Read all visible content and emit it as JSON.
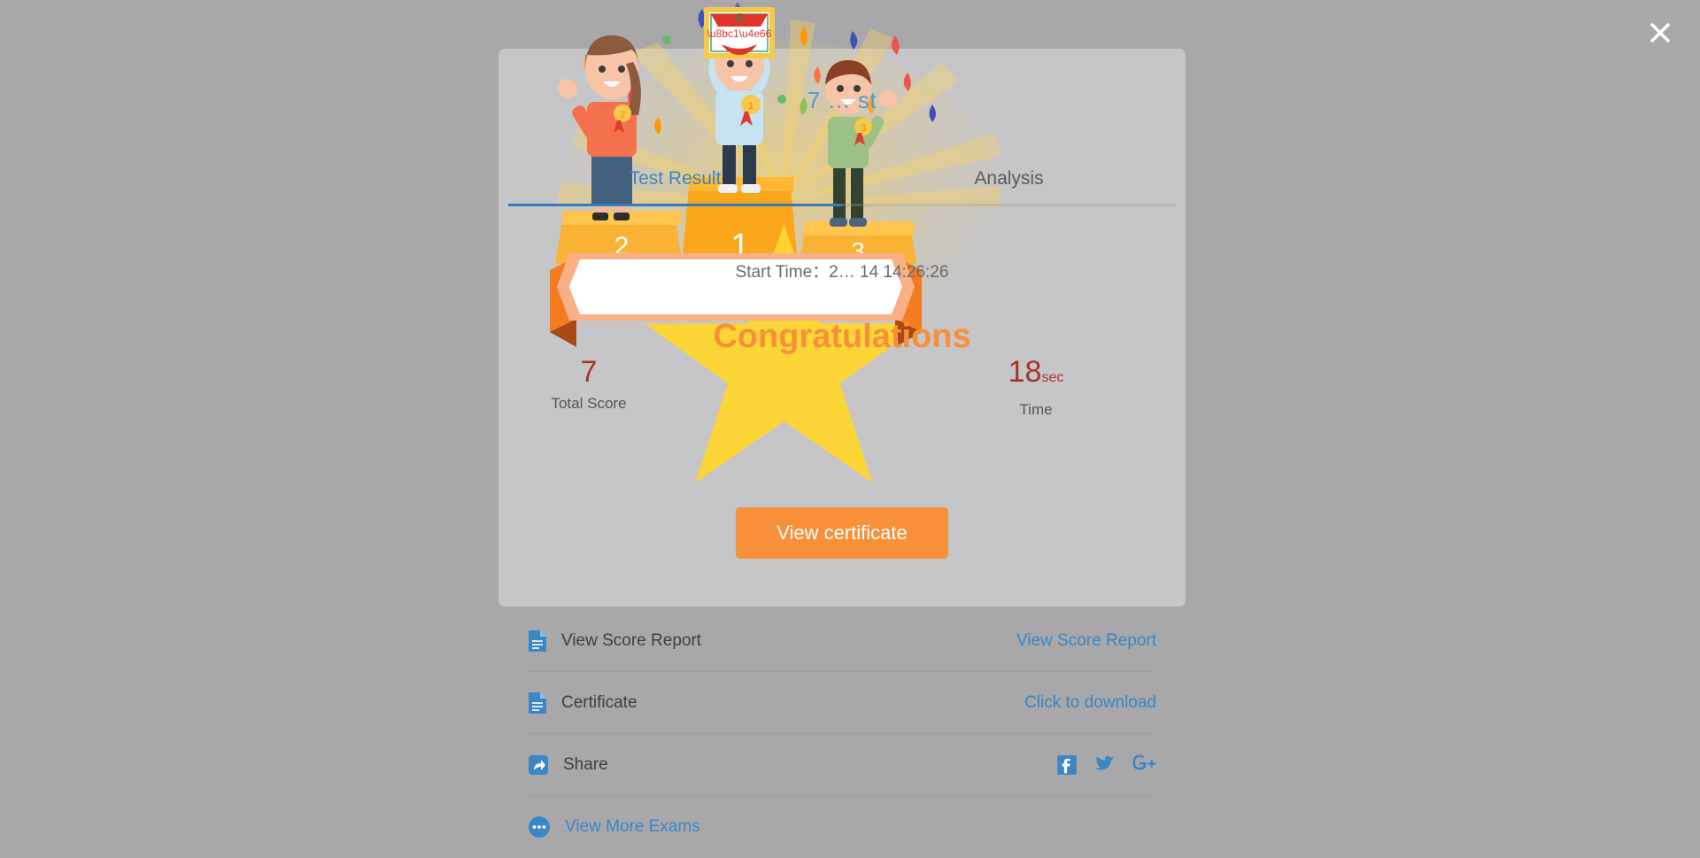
{
  "window": {
    "background_color": "#a8a8ab",
    "close_label": "✖"
  },
  "modal": {
    "exam_title": "7  …  st",
    "tabs": [
      {
        "label": "Test Result",
        "active": true
      },
      {
        "label": "Analysis",
        "active": false
      }
    ],
    "start_time": "Start Time：2… 14 14:26:26",
    "stats": [
      {
        "value": "7",
        "unit": "",
        "label": "Total Score",
        "color": "#a8342c"
      },
      {
        "value": "18",
        "unit": "sec",
        "label": "Time",
        "color": "#a8342c"
      }
    ],
    "banner_text": "Congratulations",
    "banner_color": "#f79038",
    "podium": {
      "first": "1",
      "second": "2",
      "third": "3",
      "certificate_text": "证书"
    },
    "primary_button": {
      "label": "View certificate",
      "color": "#f79038"
    },
    "actions": [
      {
        "icon": "document-icon",
        "label": "View Score Report",
        "label_is_link": false,
        "right_label": "View Score Report",
        "right_type": "link"
      },
      {
        "icon": "document-icon",
        "label": "Certificate",
        "label_is_link": false,
        "right_label": "Click to download",
        "right_type": "link"
      },
      {
        "icon": "share-icon",
        "label": "Share",
        "label_is_link": false,
        "right_label": "",
        "right_type": "social",
        "social": [
          "facebook-icon",
          "twitter-icon",
          "google-plus-icon"
        ]
      },
      {
        "icon": "more-icon",
        "label": "View More Exams",
        "label_is_link": true,
        "right_label": "",
        "right_type": "none"
      }
    ]
  },
  "colors": {
    "link_blue": "#3b86c4",
    "accent_orange": "#f79038",
    "score_red": "#a8342c",
    "podium_yellow": "#fbc02d"
  }
}
